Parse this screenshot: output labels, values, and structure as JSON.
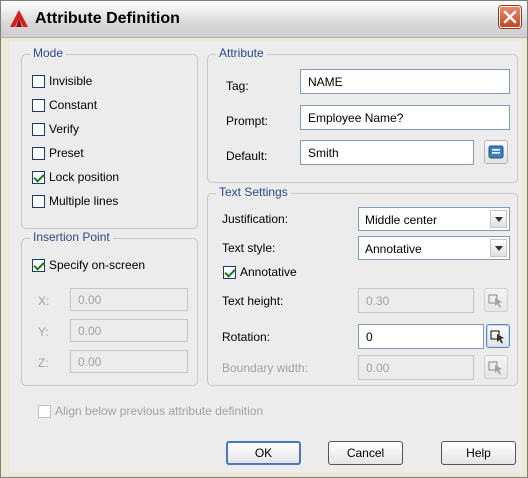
{
  "window": {
    "title": "Attribute Definition"
  },
  "mode": {
    "title": "Mode",
    "invisible": "Invisible",
    "constant": "Constant",
    "verify": "Verify",
    "preset": "Preset",
    "lock_position": "Lock position",
    "multiple_lines": "Multiple lines"
  },
  "insertion": {
    "title": "Insertion Point",
    "specify": "Specify on-screen",
    "x_label": "X:",
    "x_value": "0.00",
    "y_label": "Y:",
    "y_value": "0.00",
    "z_label": "Z:",
    "z_value": "0.00"
  },
  "attribute": {
    "title": "Attribute",
    "tag_label": "Tag:",
    "tag_value": "NAME",
    "prompt_label": "Prompt:",
    "prompt_value": "Employee Name?",
    "default_label": "Default:",
    "default_value": "Smith"
  },
  "text_settings": {
    "title": "Text Settings",
    "justification_label": "Justification:",
    "justification_value": "Middle center",
    "style_label": "Text style:",
    "style_value": "Annotative",
    "annotative": "Annotative",
    "height_label": "Text height:",
    "height_value": "0.30",
    "rotation_label": "Rotation:",
    "rotation_value": "0",
    "boundary_label": "Boundary width:",
    "boundary_value": "0.00"
  },
  "align_below": "Align below previous attribute definition",
  "buttons": {
    "ok": "OK",
    "cancel": "Cancel",
    "help": "Help"
  },
  "colors": {
    "group_title": "#2c4a8c",
    "close": "#c74520",
    "check": "#1c7a1c"
  },
  "icons": {
    "app": "autocad-logo-icon",
    "close": "close-icon",
    "field": "insert-field-icon",
    "pick": "pick-point-icon"
  }
}
